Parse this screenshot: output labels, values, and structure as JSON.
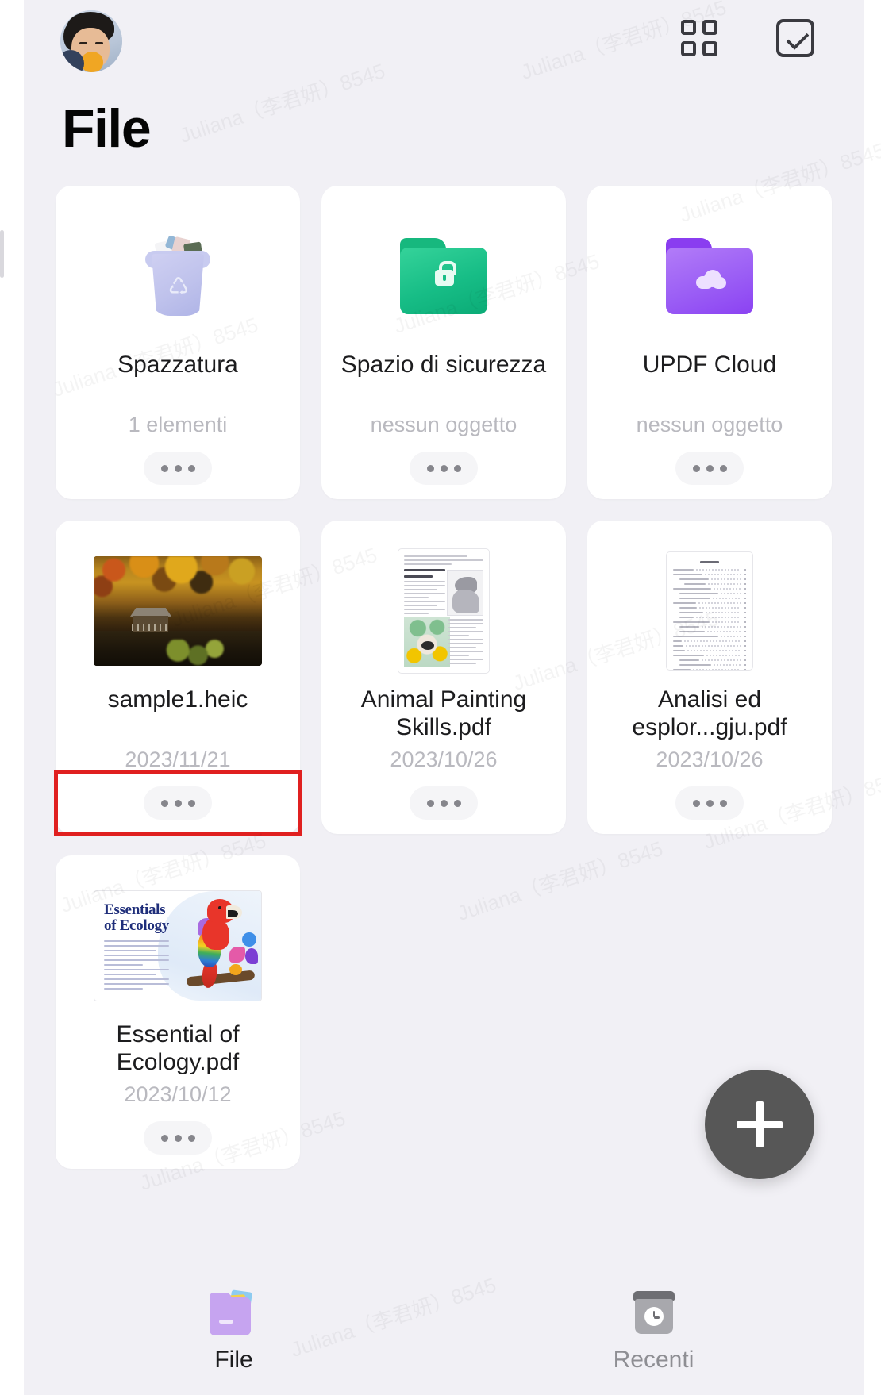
{
  "header": {
    "avatar_alt": "user-avatar",
    "grid_view_icon": "grid-view-icon",
    "select_icon": "checkbox-check-icon"
  },
  "page_title": "File",
  "cards": [
    {
      "icon": "trash-icon",
      "title": "Spazzatura",
      "subtitle": "1 elementi",
      "more_label": "•••",
      "highlighted": false
    },
    {
      "icon": "locked-folder-icon",
      "title": "Spazio di sicurezza",
      "subtitle": "nessun oggetto",
      "more_label": "•••",
      "highlighted": false
    },
    {
      "icon": "cloud-folder-icon",
      "title": "UPDF Cloud",
      "subtitle": "nessun oggetto",
      "more_label": "•••",
      "highlighted": false
    },
    {
      "icon": "image-thumbnail",
      "title": "sample1.heic",
      "subtitle": "2023/11/21",
      "more_label": "•••",
      "highlighted": true
    },
    {
      "icon": "pdf-thumbnail-animal",
      "title": "Animal Painting Skills.pdf",
      "subtitle": "2023/10/26",
      "more_label": "•••",
      "highlighted": false
    },
    {
      "icon": "pdf-thumbnail-analisi",
      "title": "Analisi ed esplor...gju.pdf",
      "subtitle": "2023/10/26",
      "more_label": "•••",
      "highlighted": false
    },
    {
      "icon": "pdf-thumbnail-ecology",
      "title": "Essential of Ecology.pdf",
      "subtitle": "2023/10/12",
      "more_label": "•••",
      "highlighted": false
    }
  ],
  "ecology_cover": {
    "line1": "Essentials",
    "line2": "of Ecology"
  },
  "fab": {
    "label": "+",
    "icon": "plus-icon"
  },
  "bottom_nav": [
    {
      "label": "File",
      "icon": "folder-icon",
      "active": true
    },
    {
      "label": "Recenti",
      "icon": "clock-icon",
      "active": false
    }
  ],
  "colors": {
    "background": "#f1f0f5",
    "card": "#ffffff",
    "title_text": "#050505",
    "subtitle_text": "#b9b9bf",
    "highlight": "#e02020",
    "fab": "#575757",
    "green_folder": "#17bd86",
    "purple_folder": "#9b5ef5",
    "nav_active": "#1c1c1e",
    "nav_inactive": "#8e8e93"
  },
  "watermarks": [
    "Juliana（李君妍）8545",
    "Juliana（李君妍）8545",
    "Juliana（李君妍）8545",
    "Juliana（李君妍）8545",
    "Juliana（李君妍）8545",
    "Juliana（李君妍）8545",
    "Juliana（李君妍）8545",
    "Juliana（李君妍）8545",
    "Juliana（李君妍）8545",
    "Juliana（李君妍）8545",
    "Juliana（李君妍）8545",
    "Juliana（李君妍）8545"
  ]
}
